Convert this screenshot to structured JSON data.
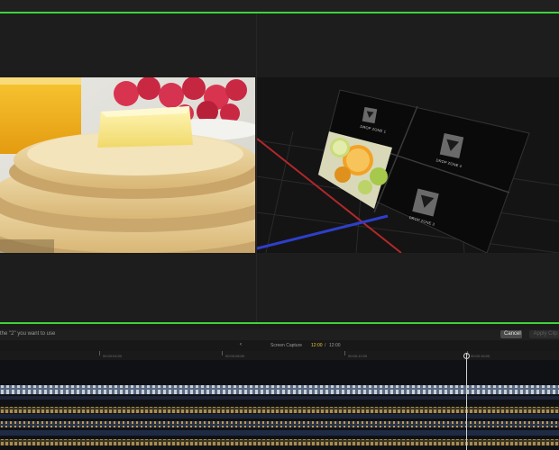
{
  "colors": {
    "accent_green": "#3fd33a",
    "timecode_yellow": "#e2c43a"
  },
  "viewer": {
    "left_clip": "pancakes-photo",
    "right_view": "3d-wall-preview",
    "dropzones": [
      {
        "label": "DROP ZONE 1"
      },
      {
        "label": "DROP ZONE 4"
      },
      {
        "label": "DROP ZONE 3"
      }
    ]
  },
  "toolbar": {
    "instruction": "the \"2\" you want to use",
    "cancel_label": "Cancel",
    "apply_label": "Apply Clip"
  },
  "subbar": {
    "back_icon": "chevron-left-icon",
    "clip_name": "Screen Capture",
    "current_tc": "12:00",
    "separator": "/",
    "total_tc": "12:00"
  },
  "ruler": {
    "labels": [
      "00:00:04:00",
      "00:00:08:00",
      "00:00:12:00",
      "00:00:16:00"
    ]
  }
}
